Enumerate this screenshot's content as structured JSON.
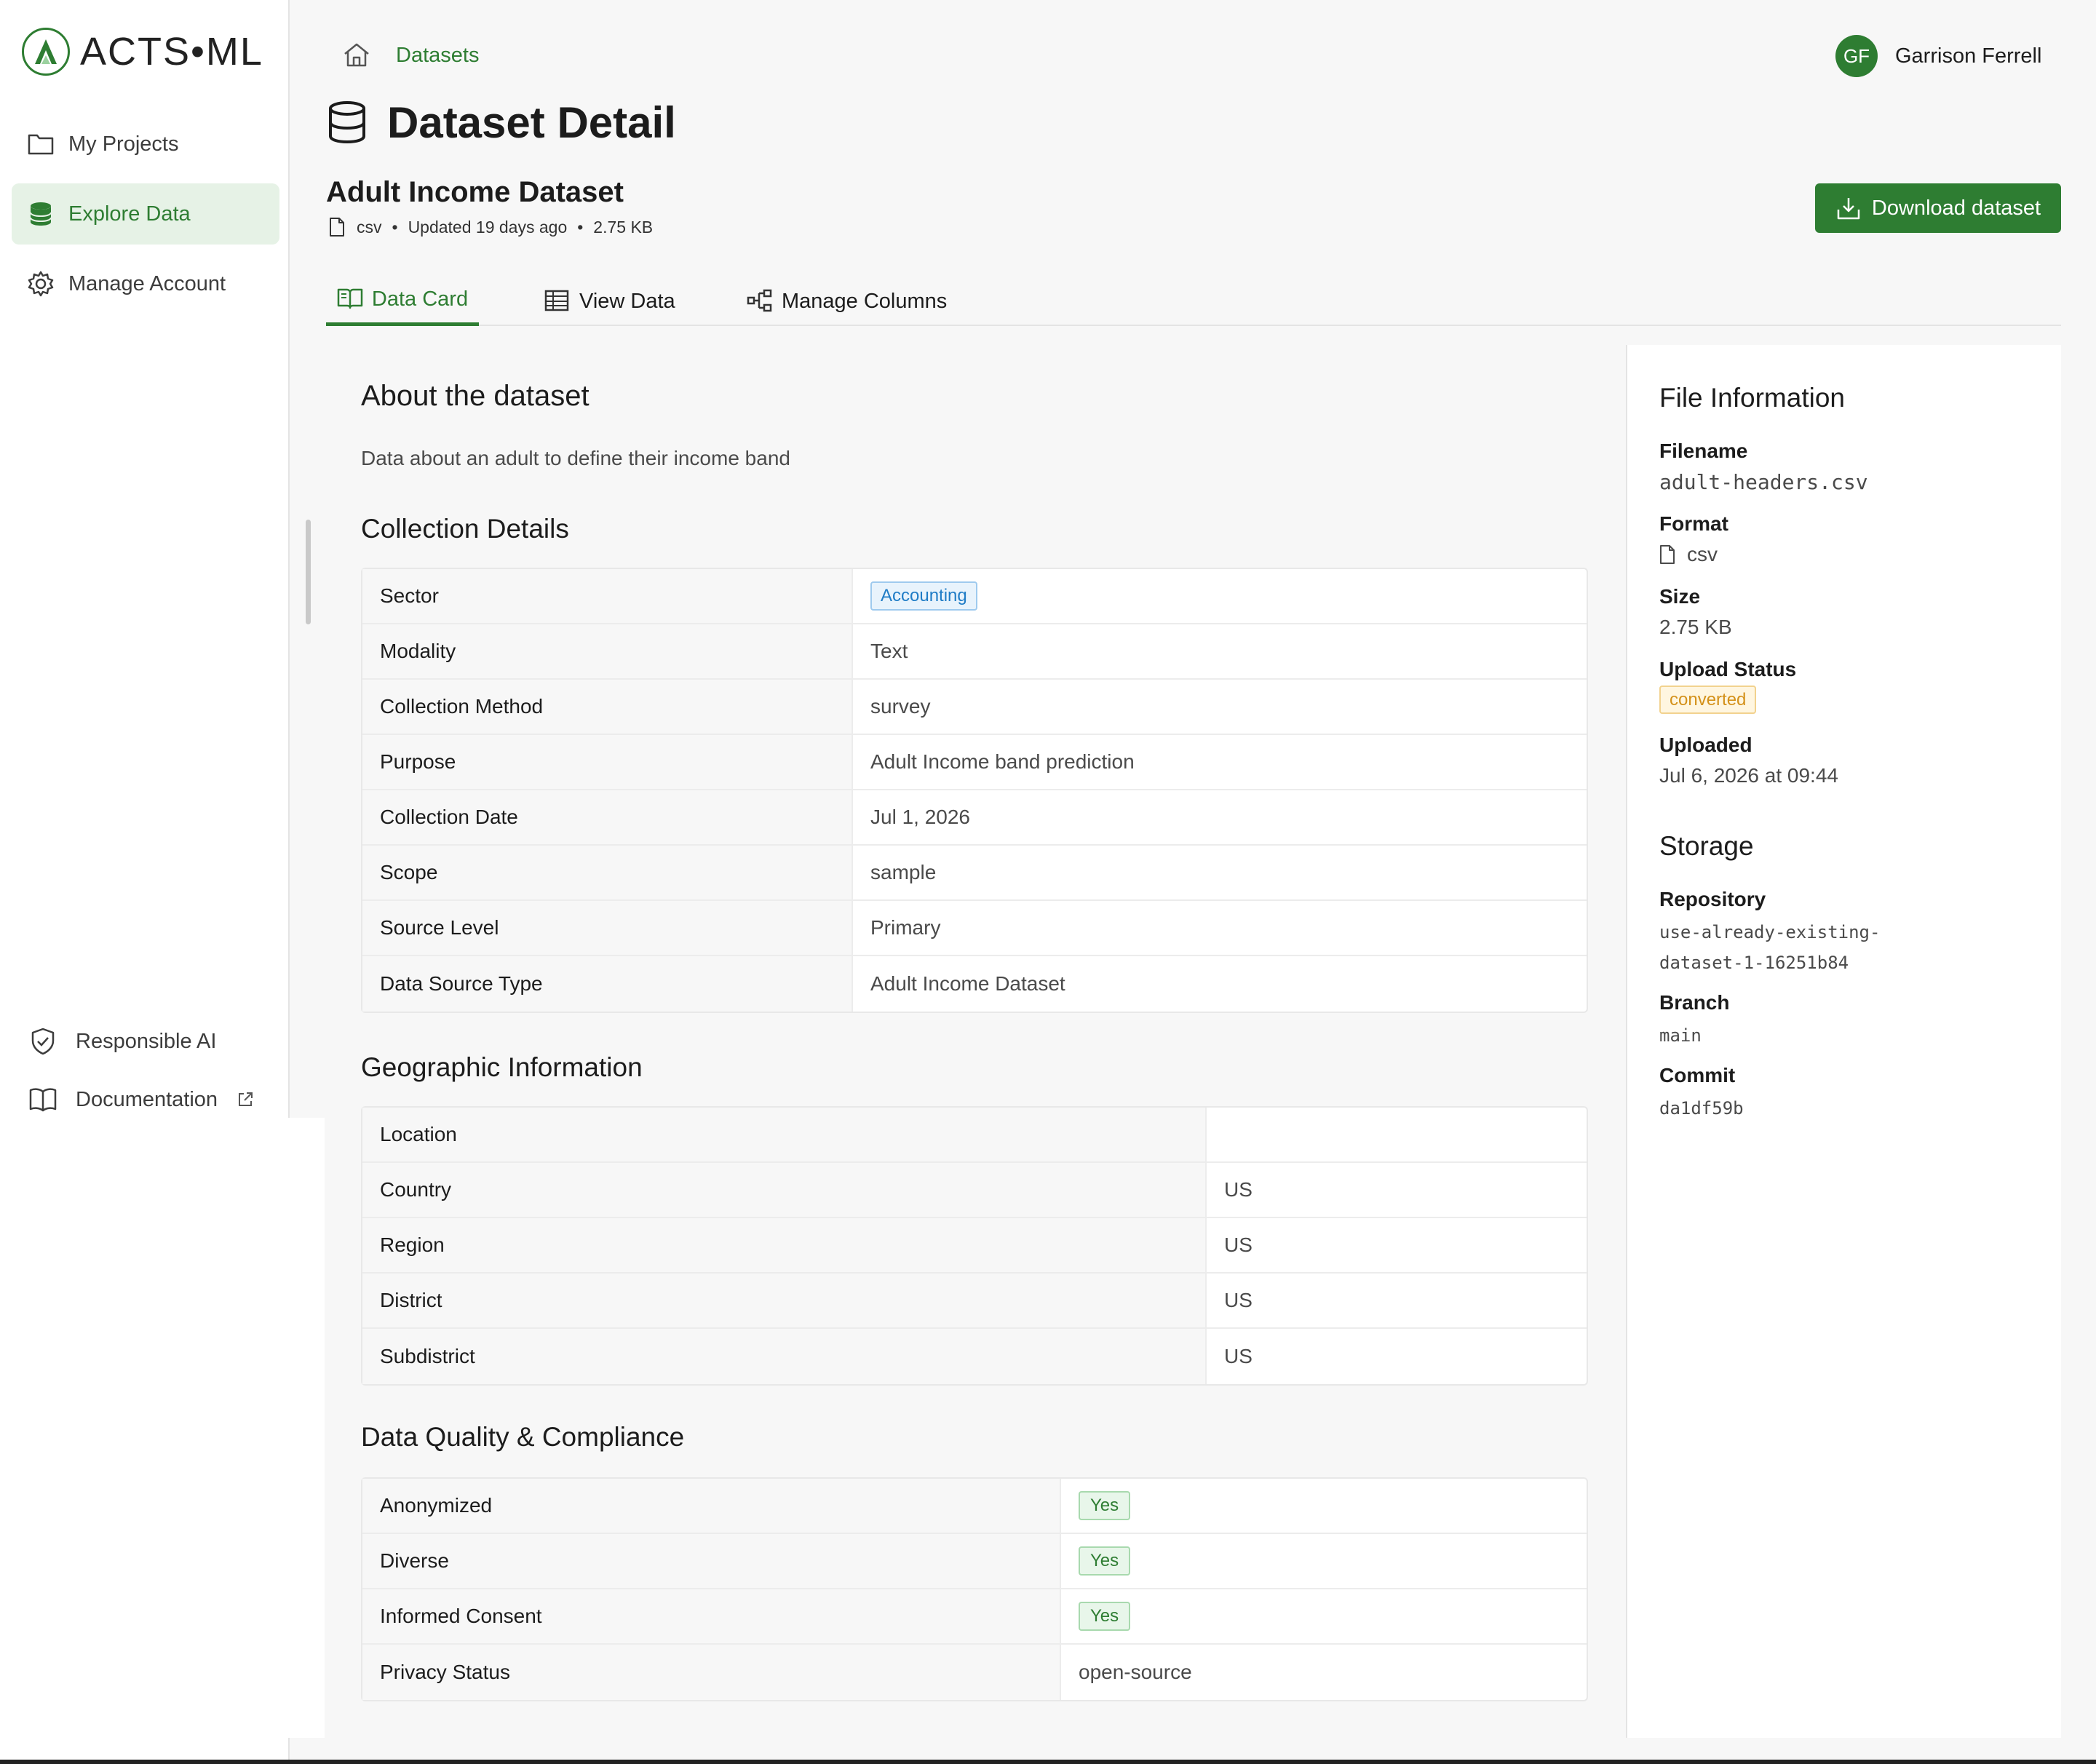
{
  "app": {
    "logo_text": "ACTS•ML"
  },
  "sidebar": {
    "items": [
      {
        "label": "My Projects",
        "icon": "folder-icon"
      },
      {
        "label": "Explore Data",
        "icon": "database-icon",
        "active": true
      },
      {
        "label": "Manage Account",
        "icon": "gear-icon"
      }
    ],
    "bottom": [
      {
        "label": "Responsible AI",
        "icon": "shield-check-icon"
      },
      {
        "label": "Documentation",
        "icon": "book-icon",
        "external": true
      }
    ]
  },
  "breadcrumb": {
    "home_icon": "home-icon",
    "items": [
      "Datasets"
    ]
  },
  "user": {
    "initials": "GF",
    "name": "Garrison Ferrell"
  },
  "page": {
    "title": "Dataset Detail"
  },
  "dataset": {
    "name": "Adult Income Dataset",
    "format": "csv",
    "updated": "Updated 19 days ago",
    "size": "2.75 KB",
    "download_label": "Download dataset"
  },
  "tabs": [
    {
      "label": "Data Card",
      "icon": "book-open-icon",
      "active": true
    },
    {
      "label": "View Data",
      "icon": "table-icon"
    },
    {
      "label": "Manage Columns",
      "icon": "columns-tree-icon"
    }
  ],
  "about": {
    "heading": "About the dataset",
    "description": "Data about an adult to define their income band"
  },
  "collection": {
    "heading": "Collection Details",
    "rows": [
      {
        "key": "Sector",
        "value": "Accounting",
        "tag": "blue"
      },
      {
        "key": "Modality",
        "value": "Text"
      },
      {
        "key": "Collection Method",
        "value": "survey"
      },
      {
        "key": "Purpose",
        "value": "Adult Income band prediction"
      },
      {
        "key": "Collection Date",
        "value": "Jul 1, 2026"
      },
      {
        "key": "Scope",
        "value": "sample"
      },
      {
        "key": "Source Level",
        "value": "Primary"
      },
      {
        "key": "Data Source Type",
        "value": "Adult Income Dataset"
      }
    ]
  },
  "geo": {
    "heading": "Geographic Information",
    "rows": [
      {
        "key": "Location",
        "value": ""
      },
      {
        "key": "Country",
        "value": "US"
      },
      {
        "key": "Region",
        "value": "US"
      },
      {
        "key": "District",
        "value": "US"
      },
      {
        "key": "Subdistrict",
        "value": "US"
      }
    ]
  },
  "quality": {
    "heading": "Data Quality & Compliance",
    "rows": [
      {
        "key": "Anonymized",
        "value": "Yes",
        "tag": "green"
      },
      {
        "key": "Diverse",
        "value": "Yes",
        "tag": "green"
      },
      {
        "key": "Informed Consent",
        "value": "Yes",
        "tag": "green"
      },
      {
        "key": "Privacy Status",
        "value": "open-source"
      }
    ]
  },
  "file_info": {
    "heading": "File Information",
    "filename_label": "Filename",
    "filename": "adult-headers.csv",
    "format_label": "Format",
    "format": "csv",
    "size_label": "Size",
    "size": "2.75 KB",
    "upload_status_label": "Upload Status",
    "upload_status": "converted",
    "uploaded_label": "Uploaded",
    "uploaded": "Jul 6, 2026 at 09:44"
  },
  "storage": {
    "heading": "Storage",
    "repository_label": "Repository",
    "repository_line1": "use-already-existing-",
    "repository_line2": "dataset-1-16251b84",
    "branch_label": "Branch",
    "branch": "main",
    "commit_label": "Commit",
    "commit": "da1df59b"
  },
  "colors": {
    "brand": "#2e7d32",
    "accent_blue": "#1f7cc6",
    "status_amber": "#d4911a"
  }
}
